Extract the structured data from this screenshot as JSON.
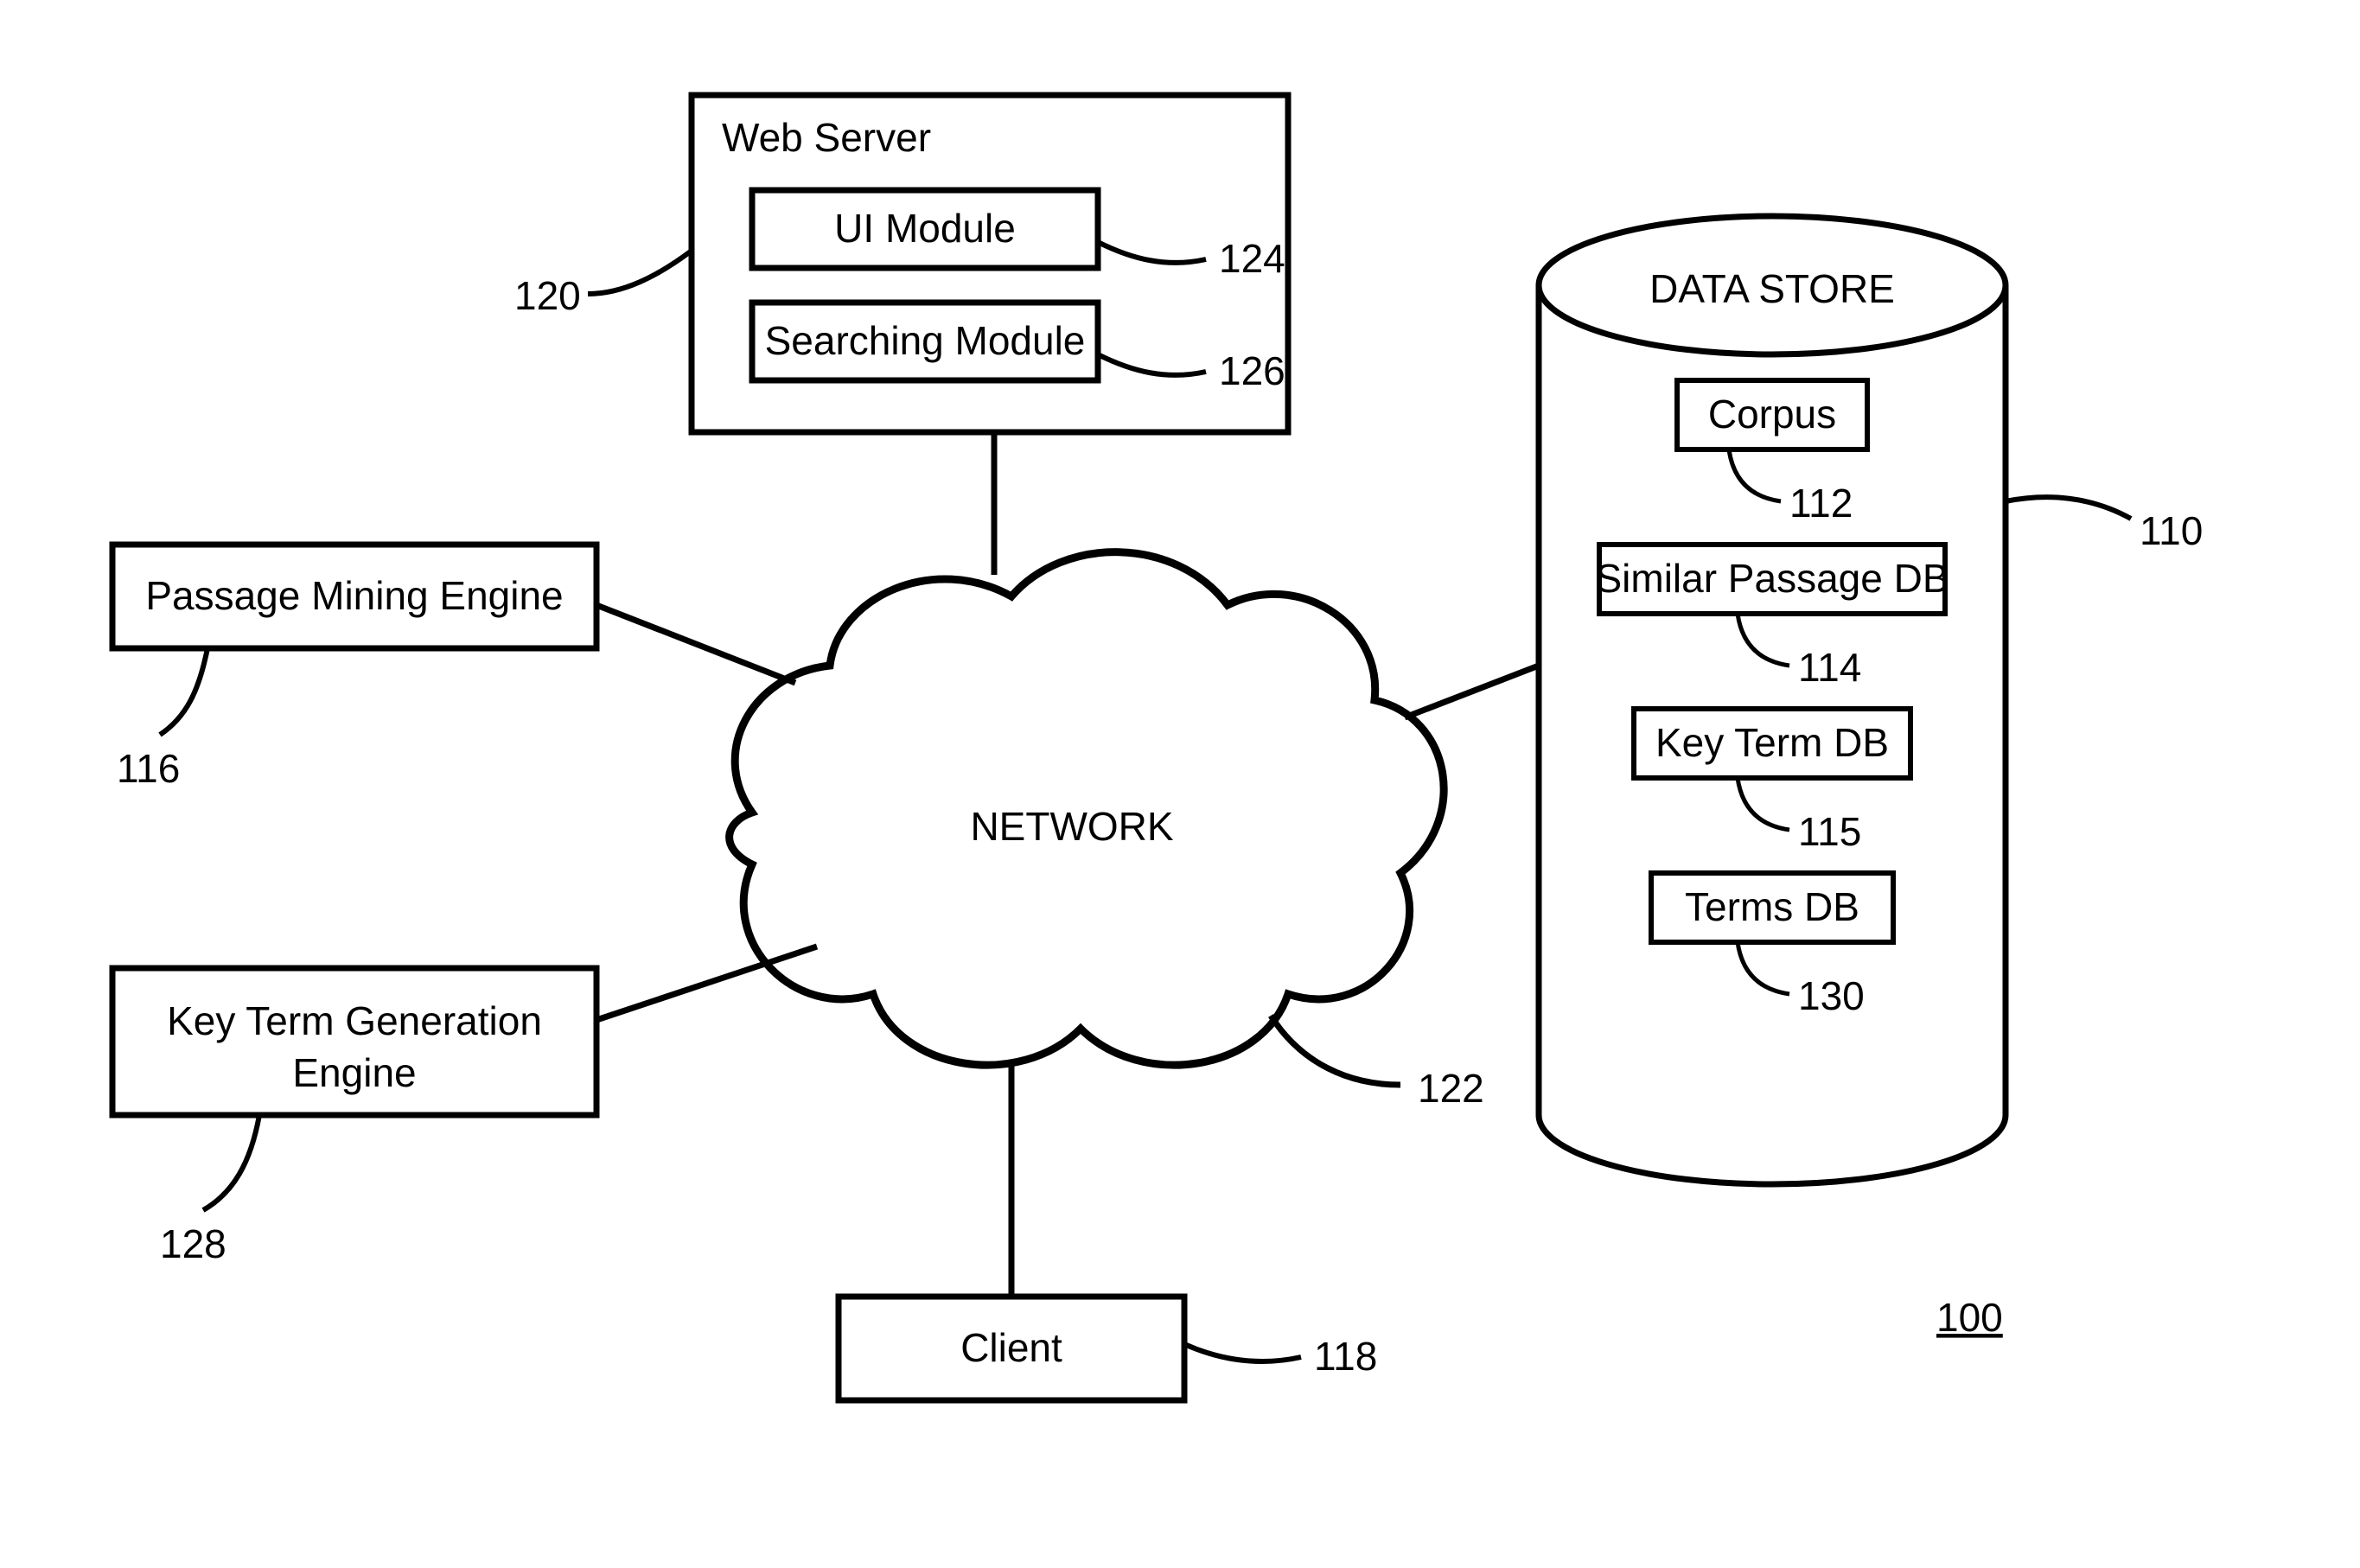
{
  "diagram": {
    "figure_ref": "100",
    "network_label": "NETWORK",
    "network_ref": "122",
    "web_server": {
      "title": "Web Server",
      "ref": "120",
      "ui_module": {
        "label": "UI Module",
        "ref": "124"
      },
      "searching_module": {
        "label": "Searching Module",
        "ref": "126"
      }
    },
    "passage_mining": {
      "label": "Passage Mining Engine",
      "ref": "116"
    },
    "key_term_gen": {
      "label_line1": "Key Term Generation",
      "label_line2": "Engine",
      "ref": "128"
    },
    "client": {
      "label": "Client",
      "ref": "118"
    },
    "data_store": {
      "title": "DATA STORE",
      "ref": "110",
      "corpus": {
        "label": "Corpus",
        "ref": "112"
      },
      "similar_passage": {
        "label": "Similar Passage DB",
        "ref": "114"
      },
      "key_term": {
        "label": "Key Term DB",
        "ref": "115"
      },
      "terms": {
        "label": "Terms DB",
        "ref": "130"
      }
    }
  }
}
